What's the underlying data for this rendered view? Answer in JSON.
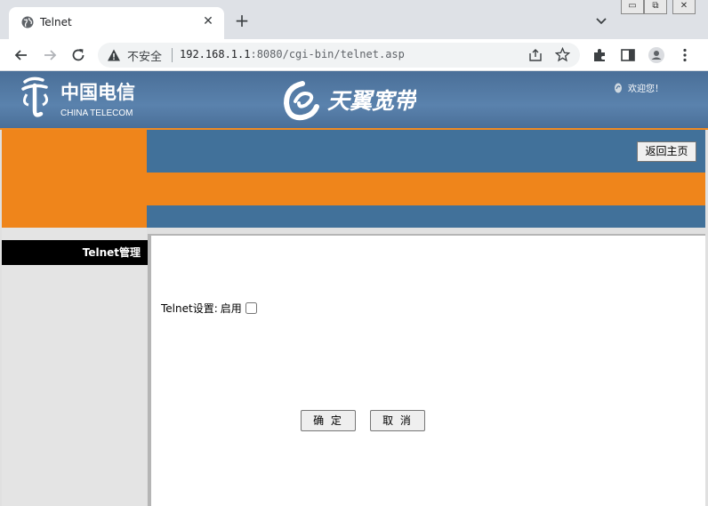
{
  "browser": {
    "tab": {
      "title": "Telnet",
      "close_glyph": "✕"
    },
    "new_tab_glyph": "+",
    "window_buttons": [
      "▭",
      "⧉",
      "✕"
    ],
    "omnibox": {
      "security_label": "不安全",
      "url_host": "192.168.1.1",
      "url_rest": ":8080/cgi-bin/telnet.asp"
    }
  },
  "banner": {
    "logo_cn": "中国电信",
    "logo_en": "CHINA TELECOM",
    "brand": "天翼宽带",
    "welcome": "欢迎您！"
  },
  "header": {
    "home_button": "返回主页"
  },
  "sidebar": {
    "items": [
      {
        "label": "Telnet管理"
      }
    ]
  },
  "form": {
    "setting_label": "Telnet设置:",
    "enable_label": "启用",
    "enabled": false,
    "ok_button": "确 定",
    "cancel_button": "取 消"
  },
  "colors": {
    "orange": "#ef851b",
    "blue": "#41719a",
    "banner": "#5a82ad"
  }
}
